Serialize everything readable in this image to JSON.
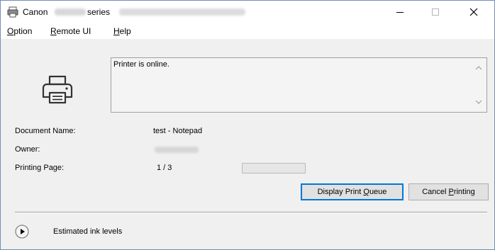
{
  "window": {
    "brand": "Canon",
    "series_word": "series"
  },
  "menu": {
    "option": {
      "accel": "O",
      "rest": "ption"
    },
    "remote_ui": {
      "accel": "R",
      "rest": "emote UI"
    },
    "help": {
      "accel": "H",
      "rest": "elp"
    }
  },
  "status": {
    "message": "Printer is online."
  },
  "details": {
    "document_name_label": "Document Name:",
    "document_name_value": "test - Notepad",
    "owner_label": "Owner:",
    "printing_page_label": "Printing Page:",
    "printing_page_value": "1 / 3",
    "progress_fraction": 0
  },
  "buttons": {
    "display_queue": {
      "before": "Display Print ",
      "accel": "Q",
      "after": "ueue"
    },
    "cancel": {
      "before": "Cancel ",
      "accel": "P",
      "after": "rinting"
    }
  },
  "ink": {
    "label": "Estimated ink levels"
  },
  "icons": [
    "printer-app-icon",
    "minimize-icon",
    "maximize-icon",
    "close-icon",
    "printer-icon",
    "chevron-up-icon",
    "chevron-down-icon",
    "play-circle-icon"
  ],
  "colors": {
    "default_button_border": "#0078d7",
    "progress_fill": "#06b025"
  }
}
